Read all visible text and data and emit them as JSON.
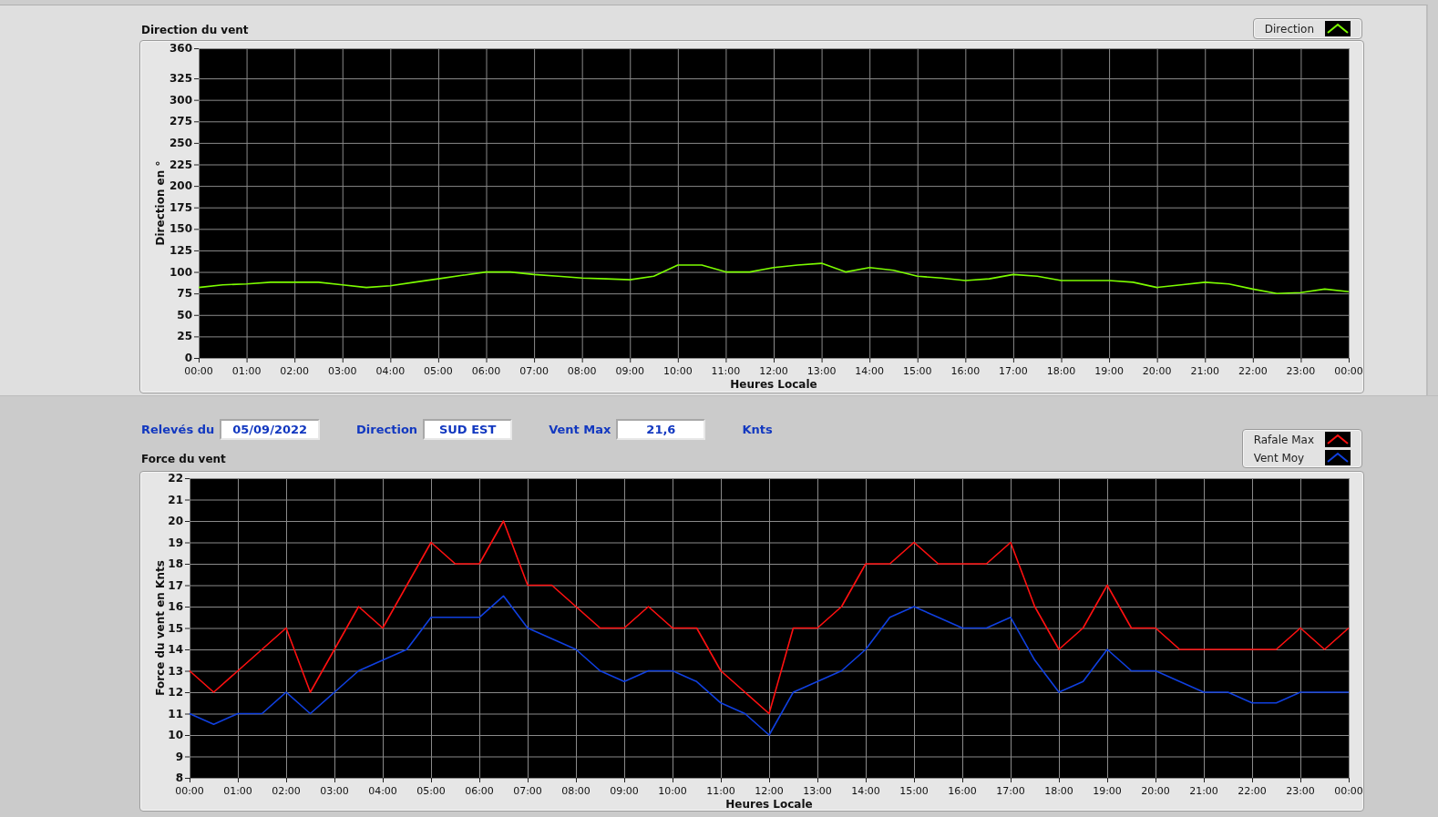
{
  "direction_chart": {
    "title": "Direction du vent",
    "chart_data": {
      "type": "line",
      "grid": true,
      "xlabel": "Heures Locale",
      "ylabel": "Direction en °",
      "x": [
        0,
        0.5,
        1,
        1.5,
        2,
        2.5,
        3,
        3.5,
        4,
        4.5,
        5,
        5.5,
        6,
        6.5,
        7,
        7.5,
        8,
        8.5,
        9,
        9.5,
        10,
        10.5,
        11,
        11.5,
        12,
        12.5,
        13,
        13.5,
        14,
        14.5,
        15,
        15.5,
        16,
        16.5,
        17,
        17.5,
        18,
        18.5,
        19,
        19.5,
        20,
        20.5,
        21,
        21.5,
        22,
        22.5,
        23,
        23.5,
        24
      ],
      "series": [
        {
          "name": "Direction",
          "color": "#7cfc00",
          "values": [
            82,
            85,
            86,
            88,
            88,
            88,
            85,
            82,
            84,
            88,
            92,
            96,
            100,
            100,
            97,
            95,
            93,
            92,
            91,
            95,
            108,
            108,
            100,
            100,
            105,
            108,
            110,
            100,
            105,
            102,
            95,
            93,
            90,
            92,
            97,
            95,
            90,
            90,
            90,
            88,
            82,
            85,
            88,
            86,
            80,
            75,
            76,
            80,
            77
          ]
        }
      ],
      "xlim": [
        0,
        24
      ],
      "ylim": [
        0,
        360
      ],
      "xticks": [
        {
          "value": 0,
          "label": "00:00"
        },
        {
          "value": 1,
          "label": "01:00"
        },
        {
          "value": 2,
          "label": "02:00"
        },
        {
          "value": 3,
          "label": "03:00"
        },
        {
          "value": 4,
          "label": "04:00"
        },
        {
          "value": 5,
          "label": "05:00"
        },
        {
          "value": 6,
          "label": "06:00"
        },
        {
          "value": 7,
          "label": "07:00"
        },
        {
          "value": 8,
          "label": "08:00"
        },
        {
          "value": 9,
          "label": "09:00"
        },
        {
          "value": 10,
          "label": "10:00"
        },
        {
          "value": 11,
          "label": "11:00"
        },
        {
          "value": 12,
          "label": "12:00"
        },
        {
          "value": 13,
          "label": "13:00"
        },
        {
          "value": 14,
          "label": "14:00"
        },
        {
          "value": 15,
          "label": "15:00"
        },
        {
          "value": 16,
          "label": "16:00"
        },
        {
          "value": 17,
          "label": "17:00"
        },
        {
          "value": 18,
          "label": "18:00"
        },
        {
          "value": 19,
          "label": "19:00"
        },
        {
          "value": 20,
          "label": "20:00"
        },
        {
          "value": 21,
          "label": "21:00"
        },
        {
          "value": 22,
          "label": "22:00"
        },
        {
          "value": 23,
          "label": "23:00"
        },
        {
          "value": 24,
          "label": "00:00"
        }
      ],
      "yticks": [
        0,
        25,
        50,
        75,
        100,
        125,
        150,
        175,
        200,
        225,
        250,
        275,
        300,
        325,
        360
      ]
    }
  },
  "readings": [
    {
      "label": "Relevés du",
      "value": "05/09/2022"
    },
    {
      "label": "Direction",
      "value": "SUD EST"
    },
    {
      "label": "Vent Max",
      "value": "21,6",
      "unit": "Knts"
    }
  ],
  "force_chart": {
    "title": "Force du vent",
    "chart_data": {
      "type": "line",
      "grid": true,
      "xlabel": "Heures Locale",
      "ylabel": "Force du vent en Knts",
      "x": [
        0,
        0.5,
        1,
        1.5,
        2,
        2.5,
        3,
        3.5,
        4,
        4.5,
        5,
        5.5,
        6,
        6.5,
        7,
        7.5,
        8,
        8.5,
        9,
        9.5,
        10,
        10.5,
        11,
        11.5,
        12,
        12.5,
        13,
        13.5,
        14,
        14.5,
        15,
        15.5,
        16,
        16.5,
        17,
        17.5,
        18,
        18.5,
        19,
        19.5,
        20,
        20.5,
        21,
        21.5,
        22,
        22.5,
        23,
        23.5,
        24
      ],
      "series": [
        {
          "name": "Rafale Max",
          "color": "#ff1010",
          "values": [
            13,
            12,
            13,
            14,
            15,
            12,
            14,
            16,
            15,
            17,
            19,
            18,
            18,
            20,
            17,
            17,
            16,
            15,
            15,
            16,
            15,
            15,
            13,
            12,
            11,
            15,
            15,
            16,
            18,
            18,
            19,
            18,
            18,
            18,
            19,
            16,
            14,
            15,
            17,
            15,
            15,
            14,
            14,
            14,
            14,
            14,
            15,
            14,
            15
          ]
        },
        {
          "name": "Vent Moy",
          "color": "#1040e0",
          "values": [
            11,
            10.5,
            11,
            11,
            12,
            11,
            12,
            13,
            13.5,
            14,
            15.5,
            15.5,
            15.5,
            16.5,
            15,
            14.5,
            14,
            13,
            12.5,
            13,
            13,
            12.5,
            11.5,
            11,
            10,
            12,
            12.5,
            13,
            14,
            15.5,
            16,
            15.5,
            15,
            15,
            15.5,
            13.5,
            12,
            12.5,
            14,
            13,
            13,
            12.5,
            12,
            12,
            11.5,
            11.5,
            12,
            12,
            12
          ]
        }
      ],
      "xlim": [
        0,
        24
      ],
      "ylim": [
        8,
        22
      ],
      "xticks": [
        {
          "value": 0,
          "label": "00:00"
        },
        {
          "value": 1,
          "label": "01:00"
        },
        {
          "value": 2,
          "label": "02:00"
        },
        {
          "value": 3,
          "label": "03:00"
        },
        {
          "value": 4,
          "label": "04:00"
        },
        {
          "value": 5,
          "label": "05:00"
        },
        {
          "value": 6,
          "label": "06:00"
        },
        {
          "value": 7,
          "label": "07:00"
        },
        {
          "value": 8,
          "label": "08:00"
        },
        {
          "value": 9,
          "label": "09:00"
        },
        {
          "value": 10,
          "label": "10:00"
        },
        {
          "value": 11,
          "label": "11:00"
        },
        {
          "value": 12,
          "label": "12:00"
        },
        {
          "value": 13,
          "label": "13:00"
        },
        {
          "value": 14,
          "label": "14:00"
        },
        {
          "value": 15,
          "label": "15:00"
        },
        {
          "value": 16,
          "label": "16:00"
        },
        {
          "value": 17,
          "label": "17:00"
        },
        {
          "value": 18,
          "label": "18:00"
        },
        {
          "value": 19,
          "label": "19:00"
        },
        {
          "value": 20,
          "label": "20:00"
        },
        {
          "value": 21,
          "label": "21:00"
        },
        {
          "value": 22,
          "label": "22:00"
        },
        {
          "value": 23,
          "label": "23:00"
        },
        {
          "value": 24,
          "label": "00:00"
        }
      ],
      "yticks": [
        8,
        9,
        10,
        11,
        12,
        13,
        14,
        15,
        16,
        17,
        18,
        19,
        20,
        21,
        22
      ]
    }
  }
}
